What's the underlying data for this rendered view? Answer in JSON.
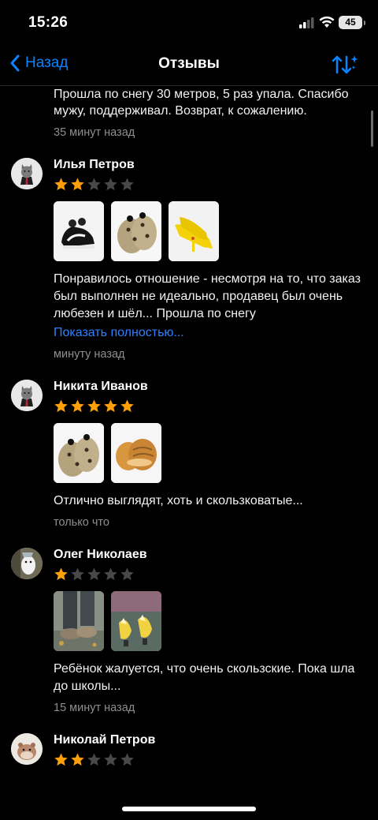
{
  "status_bar": {
    "time": "15:26",
    "battery": "45"
  },
  "nav": {
    "back_label": "Назад",
    "title": "Отзывы"
  },
  "colors": {
    "accent": "#0a84ff",
    "star_filled": "#ff9f0a",
    "star_empty": "#48484a"
  },
  "reviews": [
    {
      "text": "Прошла по снегу 30 метров, 5 раз упала. Спасибо мужу, поддерживал. Возврат, к сожалению.",
      "date": "35 минут назад"
    },
    {
      "name": "Илья Петров",
      "rating": 2,
      "photos": [
        "black-white-sneakers",
        "leopard-plush-slippers",
        "yellow-heels"
      ],
      "text": "Понравилось отношение - несмотря на то, что заказ был выполнен не идеально, продавец был очень любезен и шёл... Прошла по снегу",
      "more_label": "Показать полностью...",
      "date": "минуту назад"
    },
    {
      "name": "Никита Иванов",
      "rating": 5,
      "photos": [
        "leopard-plush-slippers",
        "bread-loaf-slippers"
      ],
      "text": "Отлично выглядят, хоть и скользковатые...",
      "date": "только что"
    },
    {
      "name": "Олег Николаев",
      "rating": 1,
      "photos": [
        "street-feet-photo",
        "banana-slippers-photo"
      ],
      "text": "Ребёнок жалуется, что очень скользские. Пока шла до школы...",
      "date": "15 минут назад"
    },
    {
      "name": "Николай Петров",
      "rating": 2
    }
  ]
}
